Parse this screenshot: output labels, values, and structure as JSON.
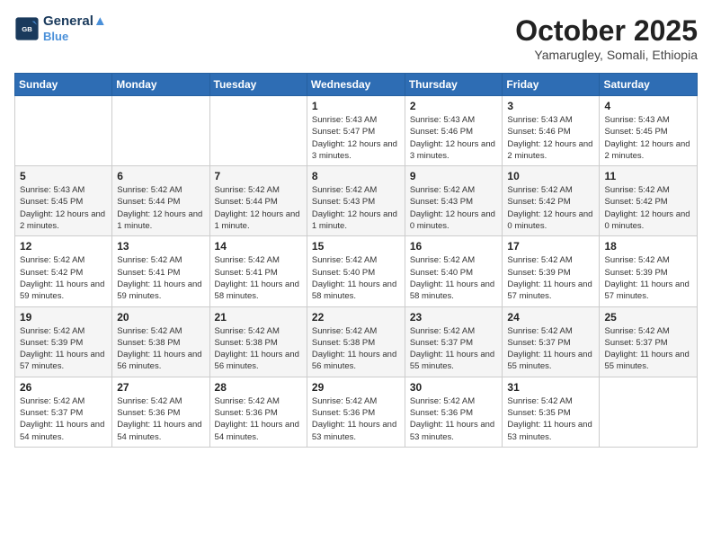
{
  "header": {
    "logo_line1": "General",
    "logo_line2": "Blue",
    "month": "October 2025",
    "location": "Yamarugley, Somali, Ethiopia"
  },
  "weekdays": [
    "Sunday",
    "Monday",
    "Tuesday",
    "Wednesday",
    "Thursday",
    "Friday",
    "Saturday"
  ],
  "weeks": [
    [
      {
        "day": "",
        "info": ""
      },
      {
        "day": "",
        "info": ""
      },
      {
        "day": "",
        "info": ""
      },
      {
        "day": "1",
        "info": "Sunrise: 5:43 AM\nSunset: 5:47 PM\nDaylight: 12 hours and 3 minutes."
      },
      {
        "day": "2",
        "info": "Sunrise: 5:43 AM\nSunset: 5:46 PM\nDaylight: 12 hours and 3 minutes."
      },
      {
        "day": "3",
        "info": "Sunrise: 5:43 AM\nSunset: 5:46 PM\nDaylight: 12 hours and 2 minutes."
      },
      {
        "day": "4",
        "info": "Sunrise: 5:43 AM\nSunset: 5:45 PM\nDaylight: 12 hours and 2 minutes."
      }
    ],
    [
      {
        "day": "5",
        "info": "Sunrise: 5:43 AM\nSunset: 5:45 PM\nDaylight: 12 hours and 2 minutes."
      },
      {
        "day": "6",
        "info": "Sunrise: 5:42 AM\nSunset: 5:44 PM\nDaylight: 12 hours and 1 minute."
      },
      {
        "day": "7",
        "info": "Sunrise: 5:42 AM\nSunset: 5:44 PM\nDaylight: 12 hours and 1 minute."
      },
      {
        "day": "8",
        "info": "Sunrise: 5:42 AM\nSunset: 5:43 PM\nDaylight: 12 hours and 1 minute."
      },
      {
        "day": "9",
        "info": "Sunrise: 5:42 AM\nSunset: 5:43 PM\nDaylight: 12 hours and 0 minutes."
      },
      {
        "day": "10",
        "info": "Sunrise: 5:42 AM\nSunset: 5:42 PM\nDaylight: 12 hours and 0 minutes."
      },
      {
        "day": "11",
        "info": "Sunrise: 5:42 AM\nSunset: 5:42 PM\nDaylight: 12 hours and 0 minutes."
      }
    ],
    [
      {
        "day": "12",
        "info": "Sunrise: 5:42 AM\nSunset: 5:42 PM\nDaylight: 11 hours and 59 minutes."
      },
      {
        "day": "13",
        "info": "Sunrise: 5:42 AM\nSunset: 5:41 PM\nDaylight: 11 hours and 59 minutes."
      },
      {
        "day": "14",
        "info": "Sunrise: 5:42 AM\nSunset: 5:41 PM\nDaylight: 11 hours and 58 minutes."
      },
      {
        "day": "15",
        "info": "Sunrise: 5:42 AM\nSunset: 5:40 PM\nDaylight: 11 hours and 58 minutes."
      },
      {
        "day": "16",
        "info": "Sunrise: 5:42 AM\nSunset: 5:40 PM\nDaylight: 11 hours and 58 minutes."
      },
      {
        "day": "17",
        "info": "Sunrise: 5:42 AM\nSunset: 5:39 PM\nDaylight: 11 hours and 57 minutes."
      },
      {
        "day": "18",
        "info": "Sunrise: 5:42 AM\nSunset: 5:39 PM\nDaylight: 11 hours and 57 minutes."
      }
    ],
    [
      {
        "day": "19",
        "info": "Sunrise: 5:42 AM\nSunset: 5:39 PM\nDaylight: 11 hours and 57 minutes."
      },
      {
        "day": "20",
        "info": "Sunrise: 5:42 AM\nSunset: 5:38 PM\nDaylight: 11 hours and 56 minutes."
      },
      {
        "day": "21",
        "info": "Sunrise: 5:42 AM\nSunset: 5:38 PM\nDaylight: 11 hours and 56 minutes."
      },
      {
        "day": "22",
        "info": "Sunrise: 5:42 AM\nSunset: 5:38 PM\nDaylight: 11 hours and 56 minutes."
      },
      {
        "day": "23",
        "info": "Sunrise: 5:42 AM\nSunset: 5:37 PM\nDaylight: 11 hours and 55 minutes."
      },
      {
        "day": "24",
        "info": "Sunrise: 5:42 AM\nSunset: 5:37 PM\nDaylight: 11 hours and 55 minutes."
      },
      {
        "day": "25",
        "info": "Sunrise: 5:42 AM\nSunset: 5:37 PM\nDaylight: 11 hours and 55 minutes."
      }
    ],
    [
      {
        "day": "26",
        "info": "Sunrise: 5:42 AM\nSunset: 5:37 PM\nDaylight: 11 hours and 54 minutes."
      },
      {
        "day": "27",
        "info": "Sunrise: 5:42 AM\nSunset: 5:36 PM\nDaylight: 11 hours and 54 minutes."
      },
      {
        "day": "28",
        "info": "Sunrise: 5:42 AM\nSunset: 5:36 PM\nDaylight: 11 hours and 54 minutes."
      },
      {
        "day": "29",
        "info": "Sunrise: 5:42 AM\nSunset: 5:36 PM\nDaylight: 11 hours and 53 minutes."
      },
      {
        "day": "30",
        "info": "Sunrise: 5:42 AM\nSunset: 5:36 PM\nDaylight: 11 hours and 53 minutes."
      },
      {
        "day": "31",
        "info": "Sunrise: 5:42 AM\nSunset: 5:35 PM\nDaylight: 11 hours and 53 minutes."
      },
      {
        "day": "",
        "info": ""
      }
    ]
  ]
}
